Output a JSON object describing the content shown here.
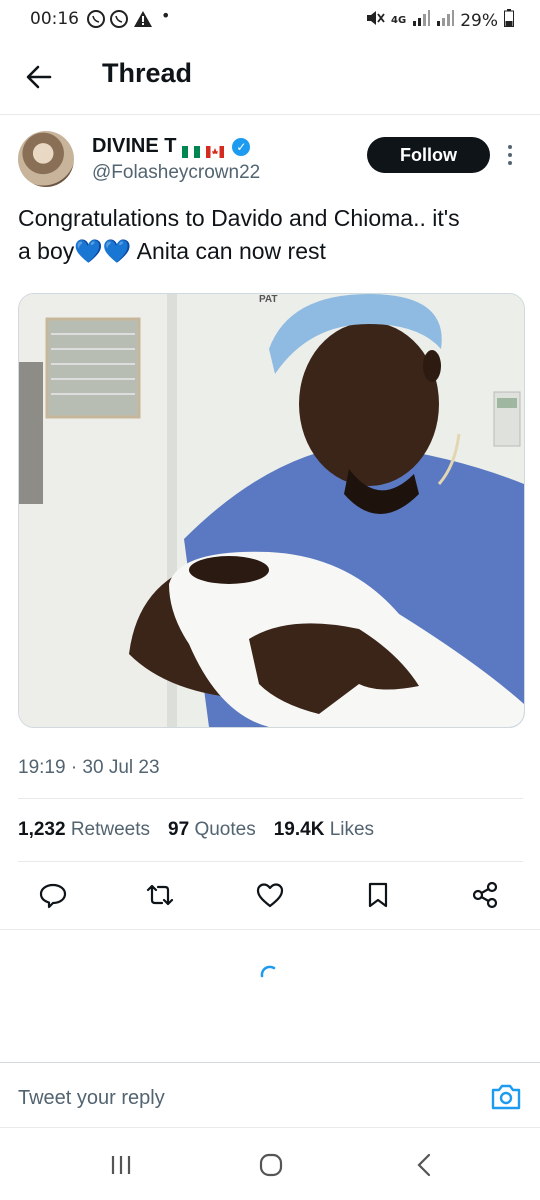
{
  "status_bar": {
    "time": "00:16",
    "network": "4G",
    "battery": "29%",
    "icons": [
      "whatsapp-icon",
      "whatsapp-icon",
      "alert-icon",
      "dot-icon",
      "mute-icon",
      "signal-icon",
      "signal-icon",
      "battery-icon"
    ]
  },
  "header": {
    "title": "Thread",
    "back_icon": "arrow-left-icon"
  },
  "tweet": {
    "display_name": "DIVINE T",
    "handle": "@Folasheycrown22",
    "follow_label": "Follow",
    "text_line1": "Congratulations to Davido and Chioma.. it's",
    "text_line2_before": "a boy",
    "text_line2_emoji": "💙💙",
    "text_line2_after": " Anita can now rest",
    "image_sign_text": "PAT",
    "timestamp": "19:19 · 30 Jul 23",
    "retweets_count": "1,232",
    "retweets_label": "Retweets",
    "quotes_count": "97",
    "quotes_label": "Quotes",
    "likes_count": "19.4K",
    "likes_label": "Likes"
  },
  "reply_bar": {
    "placeholder": "Tweet your reply"
  },
  "colors": {
    "accent": "#1d9bf0",
    "text": "#0f1419",
    "secondary": "#536471",
    "scrub": "#5c7ec7"
  }
}
